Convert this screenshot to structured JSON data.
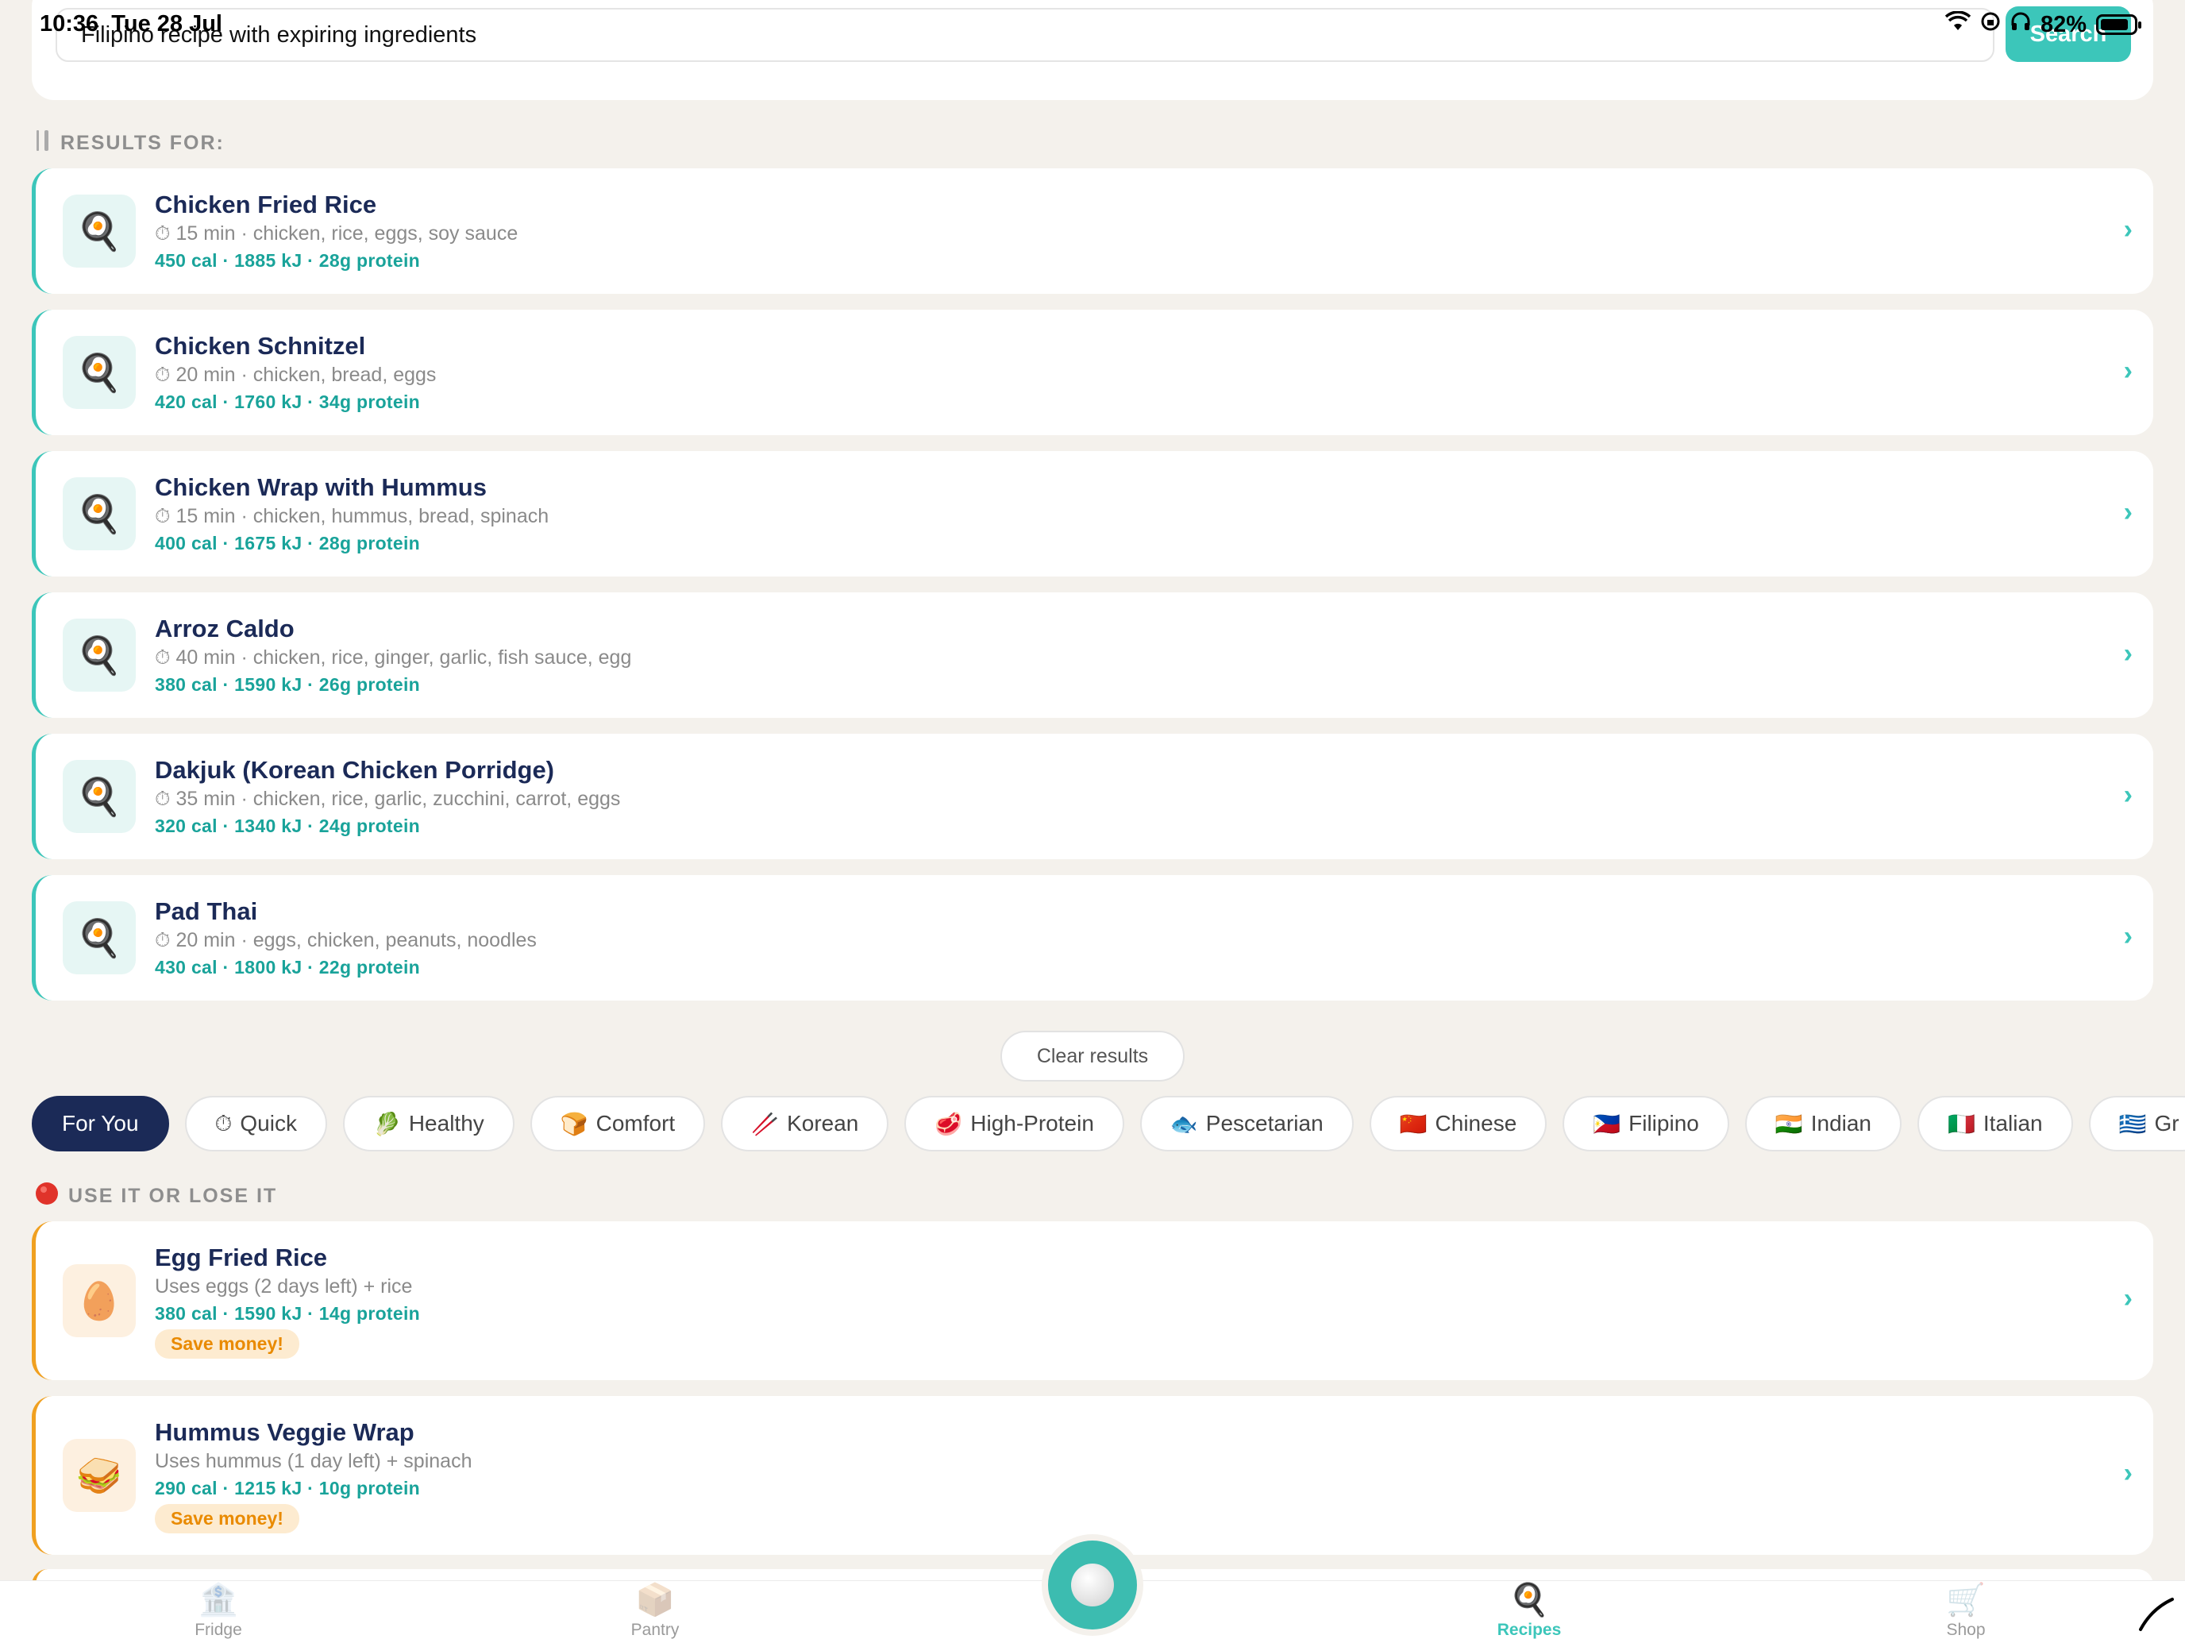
{
  "status": {
    "time": "10:36",
    "date": "Tue 28 Jul",
    "battery": "82%"
  },
  "search": {
    "value": "Filipino recipe with expiring ingredients",
    "placeholder": "",
    "button": "Search"
  },
  "results_header": "RESULTS FOR:",
  "results": [
    {
      "title": "Chicken Fried Rice",
      "meta": "15 min · chicken, rice, eggs, soy sauce",
      "nutrition": "450 cal · 1885 kJ · 28g protein",
      "icon": "🍳"
    },
    {
      "title": "Chicken Schnitzel",
      "meta": "20 min · chicken, bread, eggs",
      "nutrition": "420 cal · 1760 kJ · 34g protein",
      "icon": "🍳"
    },
    {
      "title": "Chicken Wrap with Hummus",
      "meta": "15 min · chicken, hummus, bread, spinach",
      "nutrition": "400 cal · 1675 kJ · 28g protein",
      "icon": "🍳"
    },
    {
      "title": "Arroz Caldo",
      "meta": "40 min · chicken, rice, ginger, garlic, fish sauce, egg",
      "nutrition": "380 cal · 1590 kJ · 26g protein",
      "icon": "🍳"
    },
    {
      "title": "Dakjuk (Korean Chicken Porridge)",
      "meta": "35 min · chicken, rice, garlic, zucchini, carrot, eggs",
      "nutrition": "320 cal · 1340 kJ · 24g protein",
      "icon": "🍳"
    },
    {
      "title": "Pad Thai",
      "meta": "20 min · eggs, chicken, peanuts, noodles",
      "nutrition": "430 cal · 1800 kJ · 22g protein",
      "icon": "🍳"
    }
  ],
  "timer_icon": "⏱",
  "clear_label": "Clear results",
  "chips": [
    {
      "label": "For You",
      "icon": ""
    },
    {
      "label": "Quick",
      "icon": "⏱"
    },
    {
      "label": "Healthy",
      "icon": "🥬"
    },
    {
      "label": "Comfort",
      "icon": "🍞"
    },
    {
      "label": "Korean",
      "icon": "🥢"
    },
    {
      "label": "High-Protein",
      "icon": "🥩"
    },
    {
      "label": "Pescetarian",
      "icon": "🐟"
    },
    {
      "label": "Chinese",
      "icon": "🇨🇳"
    },
    {
      "label": "Filipino",
      "icon": "🇵🇭"
    },
    {
      "label": "Indian",
      "icon": "🇮🇳"
    },
    {
      "label": "Italian",
      "icon": "🇮🇹"
    },
    {
      "label": "Gr",
      "icon": "🇬🇷"
    }
  ],
  "use_it_header": "USE IT OR LOSE IT",
  "use_it": [
    {
      "title": "Egg Fried Rice",
      "meta": "Uses eggs (2 days left) + rice",
      "nutrition": "380 cal · 1590 kJ · 14g protein",
      "badge": "Save money!",
      "icon": "🥚"
    },
    {
      "title": "Hummus Veggie Wrap",
      "meta": "Uses hummus (1 day left) + spinach",
      "nutrition": "290 cal · 1215 kJ · 10g protein",
      "badge": "Save money!",
      "icon": "🥪"
    }
  ],
  "tabs": [
    {
      "label": "Fridge",
      "icon": "🏦"
    },
    {
      "label": "Pantry",
      "icon": "📦"
    },
    {
      "label": "Recipes",
      "icon": "🍳"
    },
    {
      "label": "Shop",
      "icon": "🛒"
    }
  ],
  "colors": {
    "accent": "#3cc6ba",
    "navy": "#1b2a57",
    "orange": "#f0a020",
    "background": "#f4f1ec"
  }
}
